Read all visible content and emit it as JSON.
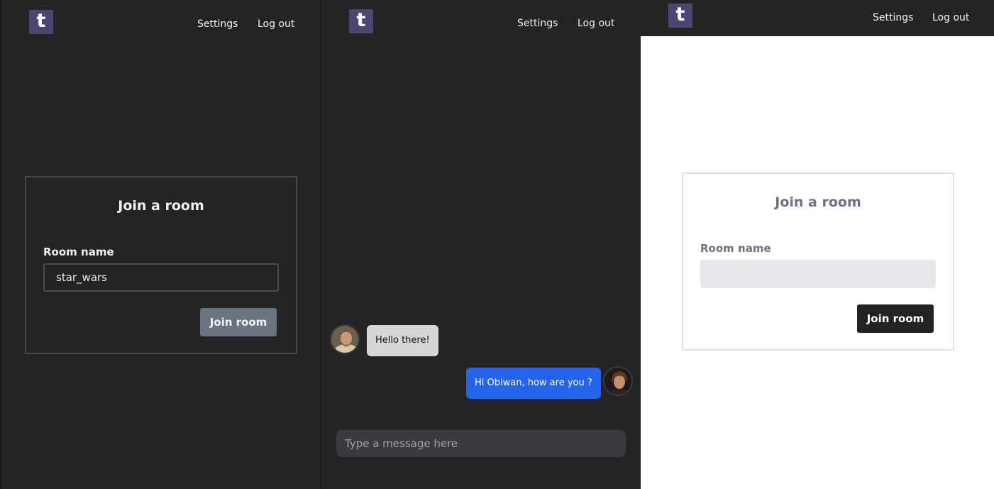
{
  "panels": [
    {
      "logo_letter": "t",
      "nav": {
        "settings": "Settings",
        "logout": "Log out"
      },
      "join": {
        "title": "Join a room",
        "room_label": "Room name",
        "room_value": "star_wars",
        "button": "Join room"
      }
    },
    {
      "logo_letter": "t",
      "nav": {
        "settings": "Settings",
        "logout": "Log out"
      },
      "messages": [
        {
          "text": "Hello there!"
        },
        {
          "text": "Hi Obiwan, how are you ?"
        }
      ],
      "input_placeholder": "Type a message here"
    },
    {
      "logo_letter": "t",
      "nav": {
        "settings": "Settings",
        "logout": "Log out"
      },
      "join": {
        "title": "Join a room",
        "room_label": "Room name",
        "room_value": "",
        "button": "Join room"
      }
    }
  ],
  "colors": {
    "dark_background": "#242426",
    "logo": "#4e4672",
    "sent_bubble": "#2563eb",
    "received_bubble": "#d6d6d9",
    "dark_button": "#6b7280",
    "light_button": "#232325"
  }
}
